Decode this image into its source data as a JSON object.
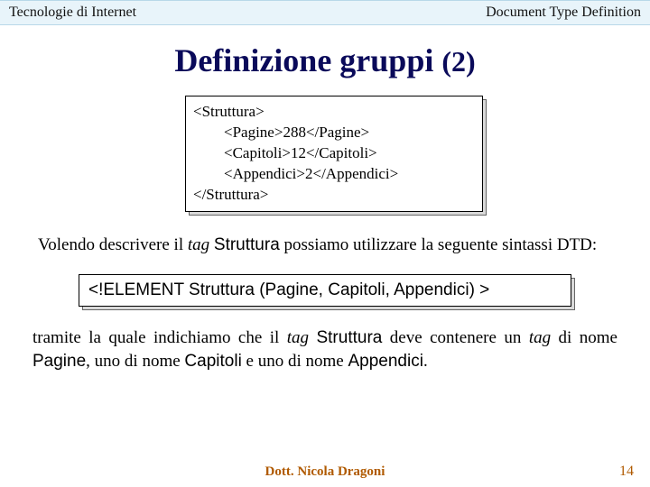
{
  "header": {
    "left": "Tecnologie di Internet",
    "right": "Document Type Definition"
  },
  "title": {
    "main": "Definizione gruppi ",
    "suffix": "(2)"
  },
  "xml_example": {
    "line1": "<Struttura>",
    "line2": "        <Pagine>288</Pagine>",
    "line3": "        <Capitoli>12</Capitoli>",
    "line4": "        <Appendici>2</Appendici>",
    "line5": "</Struttura>"
  },
  "para1": {
    "t1": "Volendo descrivere il ",
    "t2": "tag",
    "t3": " ",
    "t4": "Struttura",
    "t5": " possiamo utilizzare la seguente sintassi DTD:"
  },
  "dtd_line": "<!ELEMENT Struttura (Pagine, Capitoli, Appendici) >",
  "para2": {
    "t1": "tramite la quale indichiamo che il ",
    "t2": "tag",
    "t3": " ",
    "t4": "Struttura",
    "t5": " deve contenere un ",
    "t6": "tag",
    "t7": " di nome ",
    "t8": "Pagine",
    "t9": ", uno di nome ",
    "t10": "Capitoli",
    "t11": " e uno di nome ",
    "t12": "Appendici",
    "t13": "."
  },
  "footer": {
    "author": "Dott. Nicola Dragoni",
    "page": "14"
  }
}
